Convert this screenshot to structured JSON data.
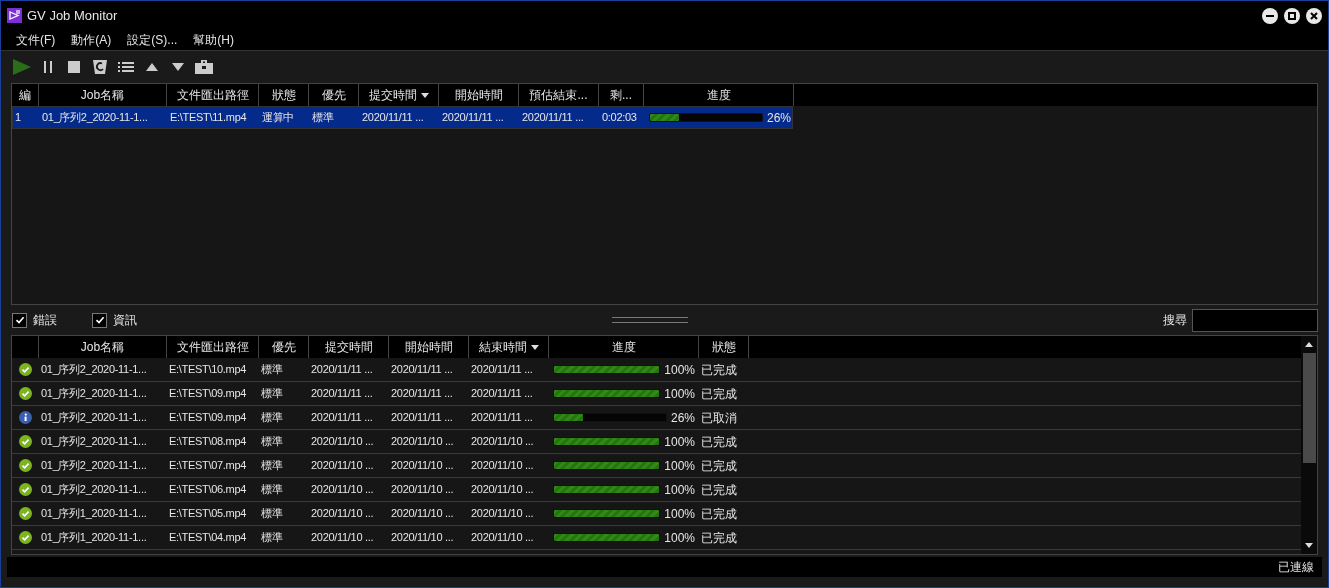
{
  "window": {
    "title": "GV Job Monitor"
  },
  "menu": [
    {
      "label": "文件(F)"
    },
    {
      "label": "動作(A)"
    },
    {
      "label": "設定(S)..."
    },
    {
      "label": "幫助(H)"
    }
  ],
  "active_jobs": {
    "columns": [
      {
        "label": "編",
        "sorted": false
      },
      {
        "label": "Job名稱",
        "sorted": false
      },
      {
        "label": "文件匯出路徑",
        "sorted": false
      },
      {
        "label": "狀態",
        "sorted": false
      },
      {
        "label": "優先",
        "sorted": false
      },
      {
        "label": "提交時間",
        "sorted": true
      },
      {
        "label": "開始時間",
        "sorted": false
      },
      {
        "label": "預估結束...",
        "sorted": false
      },
      {
        "label": "剩...",
        "sorted": false
      },
      {
        "label": "進度",
        "sorted": false
      }
    ],
    "rows": [
      {
        "selected": true,
        "cells": [
          "1",
          "01_序列2_2020-11-1...",
          "E:\\TEST\\11.mp4",
          "運算中",
          "標準",
          "2020/11/11 ...",
          "2020/11/11 ...",
          "2020/11/11 ...",
          "0:02:03"
        ],
        "level": 0.26,
        "reading": "26%"
      }
    ]
  },
  "filters": [
    {
      "label": "錯誤",
      "checked": true
    },
    {
      "label": "資訊",
      "checked": true
    }
  ],
  "search": {
    "label": "搜尋"
  },
  "history": {
    "columns": [
      {
        "label": "Job名稱",
        "sorted": false
      },
      {
        "label": "文件匯出路徑",
        "sorted": false
      },
      {
        "label": "優先",
        "sorted": false
      },
      {
        "label": "提交時間",
        "sorted": false
      },
      {
        "label": "開始時間",
        "sorted": false
      },
      {
        "label": "結束時間",
        "sorted": true
      },
      {
        "label": "進度",
        "sorted": false
      },
      {
        "label": "狀態",
        "sorted": false
      }
    ],
    "rows": [
      {
        "kind": "success",
        "cells": [
          "01_序列2_2020-11-1...",
          "E:\\TEST\\10.mp4",
          "標準",
          "2020/11/11 ...",
          "2020/11/11 ...",
          "2020/11/11 ..."
        ],
        "level": 1,
        "reading": "100%",
        "status": "已完成"
      },
      {
        "kind": "success",
        "cells": [
          "01_序列2_2020-11-1...",
          "E:\\TEST\\09.mp4",
          "標準",
          "2020/11/11 ...",
          "2020/11/11 ...",
          "2020/11/11 ..."
        ],
        "level": 1,
        "reading": "100%",
        "status": "已完成"
      },
      {
        "kind": "info",
        "cells": [
          "01_序列2_2020-11-1...",
          "E:\\TEST\\09.mp4",
          "標準",
          "2020/11/11 ...",
          "2020/11/11 ...",
          "2020/11/11 ..."
        ],
        "level": 0.26,
        "reading": "26%",
        "status": "已取消"
      },
      {
        "kind": "success",
        "cells": [
          "01_序列2_2020-11-1...",
          "E:\\TEST\\08.mp4",
          "標準",
          "2020/11/10 ...",
          "2020/11/10 ...",
          "2020/11/10 ..."
        ],
        "level": 1,
        "reading": "100%",
        "status": "已完成"
      },
      {
        "kind": "success",
        "cells": [
          "01_序列2_2020-11-1...",
          "E:\\TEST\\07.mp4",
          "標準",
          "2020/11/10 ...",
          "2020/11/10 ...",
          "2020/11/10 ..."
        ],
        "level": 1,
        "reading": "100%",
        "status": "已完成"
      },
      {
        "kind": "success",
        "cells": [
          "01_序列2_2020-11-1...",
          "E:\\TEST\\06.mp4",
          "標準",
          "2020/11/10 ...",
          "2020/11/10 ...",
          "2020/11/10 ..."
        ],
        "level": 1,
        "reading": "100%",
        "status": "已完成"
      },
      {
        "kind": "success",
        "cells": [
          "01_序列1_2020-11-1...",
          "E:\\TEST\\05.mp4",
          "標準",
          "2020/11/10 ...",
          "2020/11/10 ...",
          "2020/11/10 ..."
        ],
        "level": 1,
        "reading": "100%",
        "status": "已完成"
      },
      {
        "kind": "success",
        "cells": [
          "01_序列1_2020-11-1...",
          "E:\\TEST\\04.mp4",
          "標準",
          "2020/11/10 ...",
          "2020/11/10 ...",
          "2020/11/10 ..."
        ],
        "level": 1,
        "reading": "100%",
        "status": "已完成"
      }
    ]
  },
  "status_bar": {
    "text": "已連線"
  }
}
